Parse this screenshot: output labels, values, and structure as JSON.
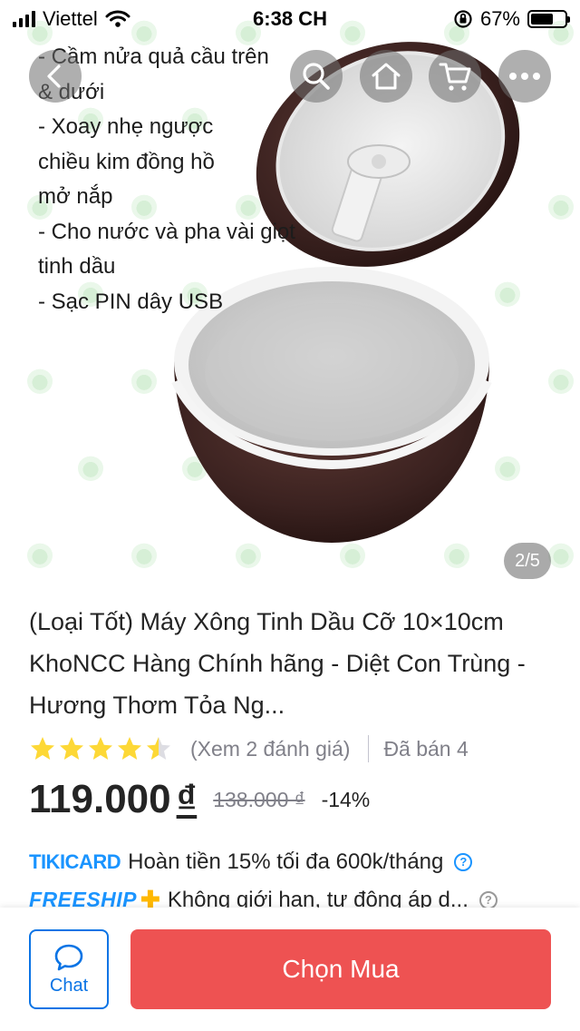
{
  "status_bar": {
    "carrier": "Viettel",
    "time": "6:38 CH",
    "battery": "67%",
    "battery_level": 0.67
  },
  "hero": {
    "instructions": [
      "- Cầm nửa quả cầu trên",
      "& dưới",
      "- Xoay nhẹ ngược",
      "chiều kim đồng hồ",
      "mở nắp",
      "- Cho nước và pha vài giọt",
      "tinh dầu",
      "- Sạc PIN dây USB"
    ],
    "counter": "2/5"
  },
  "nav": {
    "back_icon": "chevron-left-icon",
    "search_icon": "search-icon",
    "home_icon": "home-icon",
    "cart_icon": "cart-icon",
    "more_icon": "more-icon"
  },
  "product": {
    "title": "(Loại Tốt) Máy Xông Tinh Dầu Cỡ 10×10cm KhoNCC Hàng Chính hãng - Diệt Con Trùng - Hương Thơm Tỏa Ng...",
    "rating": 4.5,
    "reviews_text": "(Xem 2 đánh giá)",
    "sold_text": "Đã bán 4",
    "price": "119.000",
    "currency": "₫",
    "old_price": "138.000 ₫",
    "discount": "-14%"
  },
  "promos": {
    "tikicard_logo": "TIKICARD",
    "tikicard_text": "Hoàn tiền 15% tối đa 600k/tháng",
    "freeship_logo": "FREESHIP",
    "freeship_text": "Không giới hạn, tự động áp d..."
  },
  "bottom_bar": {
    "chat_label": "Chat",
    "buy_label": "Chọn Mua"
  },
  "colors": {
    "accent_blue": "#1a94ff",
    "buy_red": "#ee5252",
    "star_yellow": "#fdd836",
    "product_brown": "#3b2220"
  }
}
